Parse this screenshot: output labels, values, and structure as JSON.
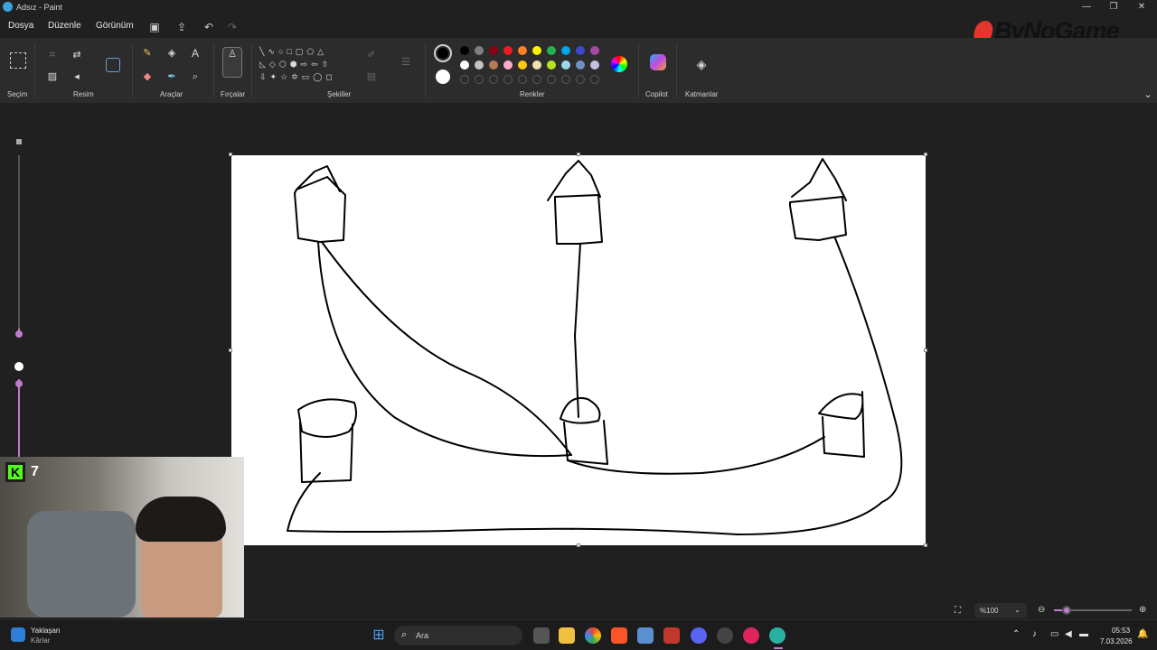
{
  "window": {
    "title": "Adsız - Paint"
  },
  "menu": {
    "file": "Dosya",
    "edit": "Düzenle",
    "view": "Görünüm"
  },
  "ribbon": {
    "groups": {
      "selection": "Seçim",
      "image": "Resim",
      "tools": "Araçlar",
      "brushes": "Fırçalar",
      "shapes": "Şekiller",
      "colors": "Renkler",
      "copilot": "Copilot",
      "layers": "Katmanlar"
    },
    "palette_row1": [
      "#000000",
      "#7f7f7f",
      "#880015",
      "#ed1c24",
      "#ff7f27",
      "#fff200",
      "#22b14c",
      "#00a2e8",
      "#3f48cc",
      "#a349a4"
    ],
    "palette_row2": [
      "#ffffff",
      "#c3c3c3",
      "#b97a57",
      "#ffaec9",
      "#ffc90e",
      "#efe4b0",
      "#b5e61d",
      "#99d9ea",
      "#7092be",
      "#c8bfe7"
    ],
    "primary_color": "#000000",
    "secondary_color": "#ffffff"
  },
  "watermark": {
    "logo_text": "ByNoGame"
  },
  "stream_overlay": {
    "badge": "7"
  },
  "status": {
    "zoom": "%100"
  },
  "taskbar": {
    "weather_title": "Yaklaşan",
    "weather_sub": "Kârlar",
    "search_placeholder": "Ara",
    "time": "05:53",
    "date": "7.03.2026"
  }
}
